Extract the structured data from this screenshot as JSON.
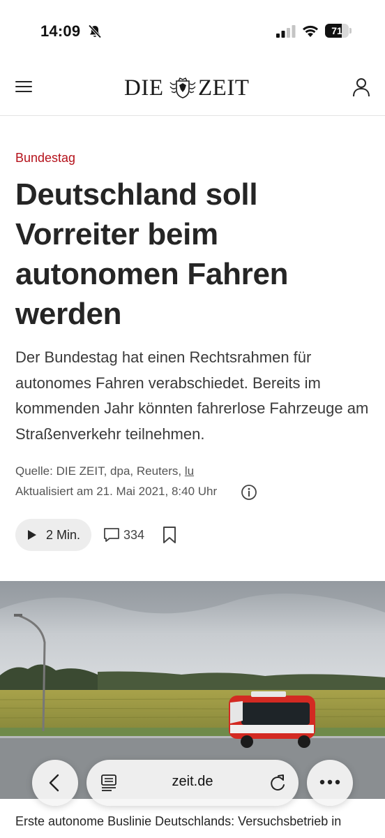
{
  "status_bar": {
    "time": "14:09",
    "battery_level": "71",
    "battery_fraction": 0.71,
    "icons": [
      "bell-slash-icon",
      "signal-icon",
      "wifi-icon",
      "battery-icon"
    ]
  },
  "header": {
    "logo_left": "DIE",
    "logo_right": "ZEIT",
    "icons": [
      "menu-icon",
      "crest-icon",
      "user-icon"
    ]
  },
  "article": {
    "kicker": "Bundestag",
    "headline": "Deutschland soll Vorreiter beim autonomen Fahren werden",
    "teaser": "Der Bundestag hat einen Rechtsrahmen für autonomes Fahren verabschiedet. Bereits im kommenden Jahr könnten fahrerlose Fahrzeuge am Straßenverkehr teilnehmen.",
    "source_prefix": "Quelle: DIE ZEIT, dpa, Reuters, ",
    "source_author": "lu",
    "updated": "Aktualisiert am 21. Mai 2021, 8:40 Uhr",
    "listen_label": "2 Min.",
    "comment_count": "334",
    "caption": "Erste autonome Buslinie Deutschlands: Versuchsbetrieb in"
  },
  "browser": {
    "url": "zeit.de",
    "icons": [
      "chevron-left-icon",
      "reader-icon",
      "reload-icon",
      "more-icon"
    ]
  },
  "colors": {
    "kicker": "#b5121b",
    "text": "#252525",
    "bus_red": "#d32a22"
  }
}
